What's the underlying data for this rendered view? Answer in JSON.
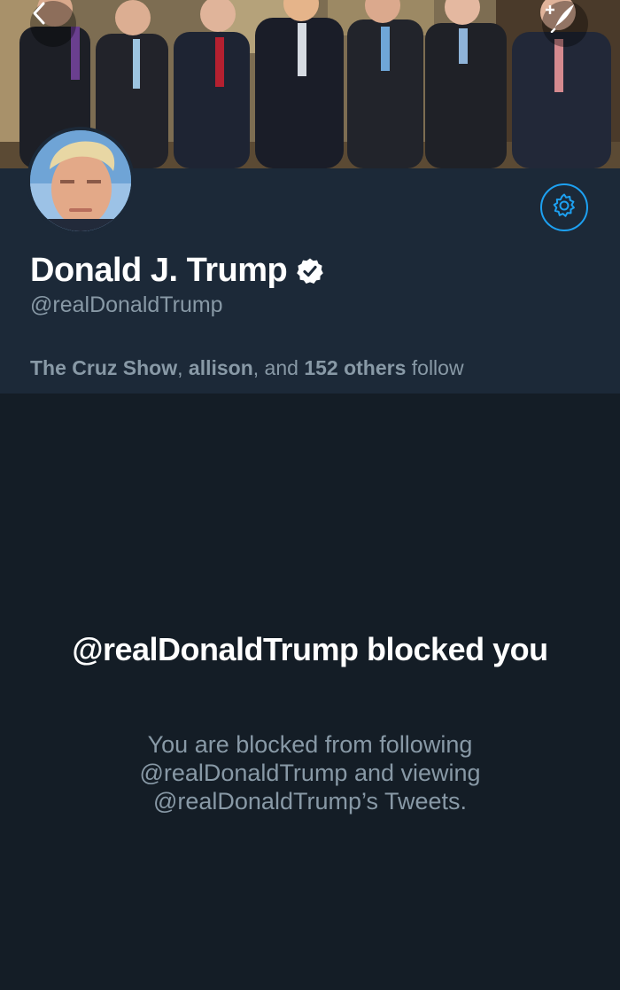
{
  "colors": {
    "background": "#141d26",
    "header_background": "#1c2938",
    "accent": "#1da1f2",
    "text_primary": "#ffffff",
    "text_secondary": "#8899a6"
  },
  "navigation": {
    "back_icon": "chevron-left-icon",
    "compose_icon": "compose-tweet-icon"
  },
  "profile": {
    "banner": "group-photo-banner",
    "avatar": "profile-avatar",
    "display_name": "Donald J. Trump",
    "verified_icon": "verified-badge-icon",
    "handle": "@realDonaldTrump",
    "settings_icon": "gear-icon",
    "followers_you_know": {
      "names": [
        "The Cruz Show",
        "allison"
      ],
      "sep1": ", ",
      "sep2": ", and ",
      "others": "152 others",
      "suffix": " follow"
    }
  },
  "blocked": {
    "title": "@realDonaldTrump blocked you",
    "message": "You are blocked from following @realDonaldTrump and viewing @realDonaldTrump’s Tweets."
  }
}
